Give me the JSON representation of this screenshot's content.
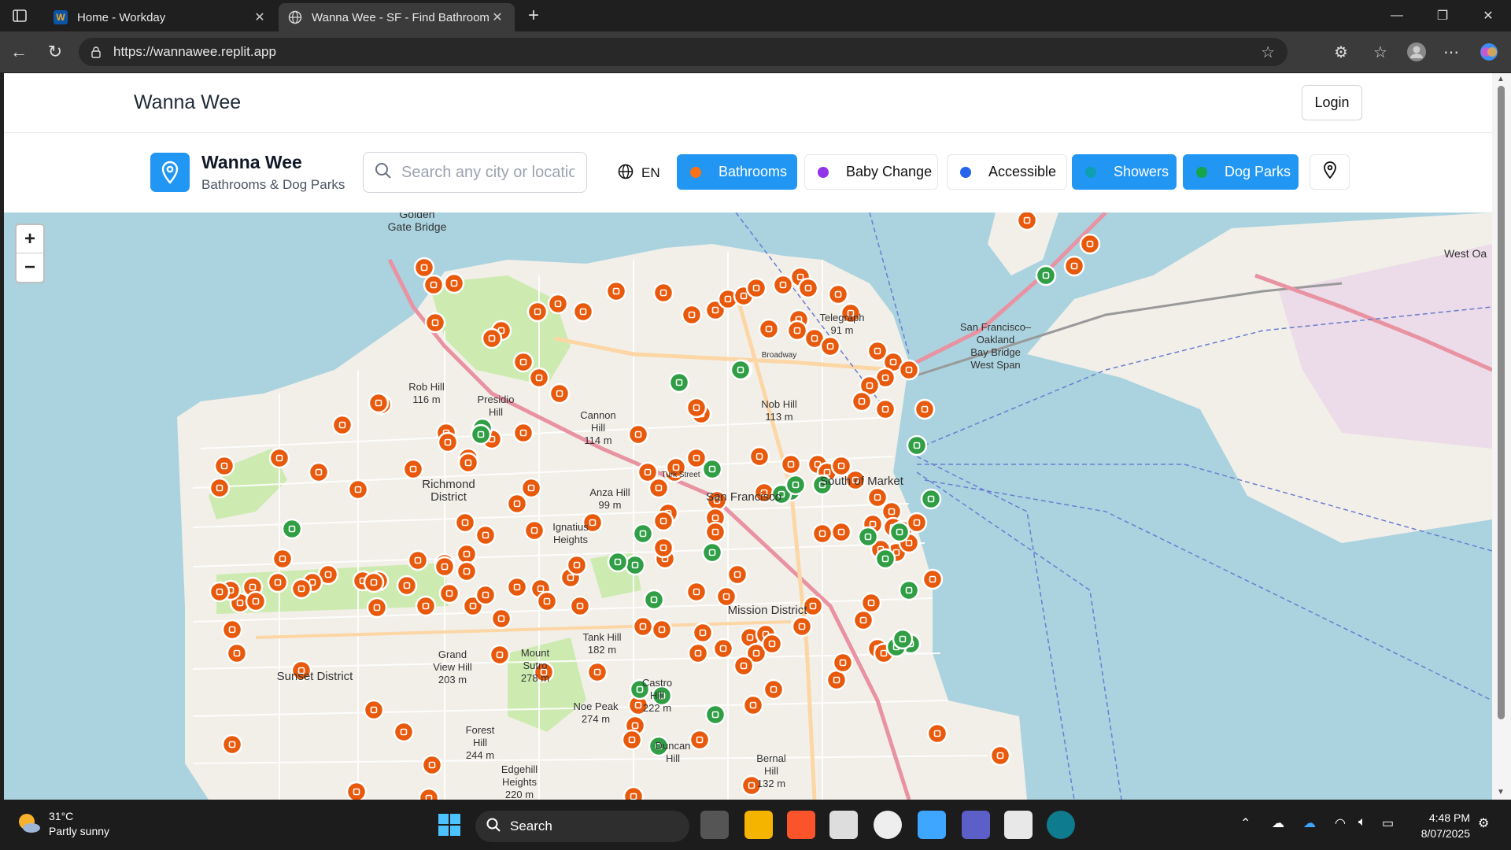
{
  "browser": {
    "tabs": [
      {
        "title": "Home - Workday",
        "active": false
      },
      {
        "title": "Wanna Wee - SF - Find Bathroom",
        "active": true
      }
    ],
    "url": "https://wannawee.replit.app"
  },
  "header": {
    "brand": "Wanna Wee",
    "login_label": "Login"
  },
  "toolbar": {
    "logo_title": "Wanna Wee",
    "logo_subtitle": "Bathrooms & Dog Parks",
    "search_placeholder": "Search any city or location",
    "lang": "EN",
    "filters": [
      {
        "label": "Bathrooms",
        "dot": "#f97316",
        "active": true
      },
      {
        "label": "Baby Change",
        "dot": "#9333ea",
        "active": false
      },
      {
        "label": "Accessible",
        "dot": "#2563eb",
        "active": false
      },
      {
        "label": "Showers",
        "dot": "#0e9fb3",
        "active": true
      },
      {
        "label": "Dog Parks",
        "dot": "#16a34a",
        "active": true
      }
    ]
  },
  "map": {
    "zoom_in": "+",
    "zoom_out": "−",
    "labels": {
      "golden_gate": "Golden\nGate Bridge",
      "rob_hill": "Rob Hill\n116 m",
      "presidio_hill": "Presidio\nHill",
      "richmond": "Richmond\nDistrict",
      "canon_hill": "Cannon\nHill\n114 m",
      "nob_hill": "Nob Hill\n113 m",
      "telegraph": "Telegraph\n91 m",
      "soma": "South of Market",
      "san_francisco": "San Francisco",
      "anza_hill": "Anza Hill\n99 m",
      "ignatius": "Ignatius\nHeights",
      "sunset": "Sunset District",
      "grand_view": "Grand\nView Hill\n203 m",
      "mount_sutro": "Mount\nSutro\n278 m",
      "tank_hill": "Tank Hill\n182 m",
      "noe_peak": "Noe Peak\n274 m",
      "castro_hill": "Castro\nHill\n222 m",
      "forest_hill": "Forest\nHill\n244 m",
      "edgehill": "Edgehill\nHeights\n220 m",
      "mission": "Mission District",
      "duncan": "Duncan\nHill",
      "bernal": "Bernal\nHill\n132 m",
      "bay_bridge": "San Francisco–\nOakland\nBay Bridge\nWest Span",
      "west_oakland": "West Oa",
      "broadway": "Broadway",
      "turk": "Turk Street"
    },
    "markers": {
      "bathroom_color": "#e8590c",
      "dogpark_color": "#2f9e44"
    }
  },
  "taskbar": {
    "temp": "31°C",
    "condition": "Partly sunny",
    "search_label": "Search",
    "time": "4:48 PM",
    "date": "8/07/2025"
  }
}
